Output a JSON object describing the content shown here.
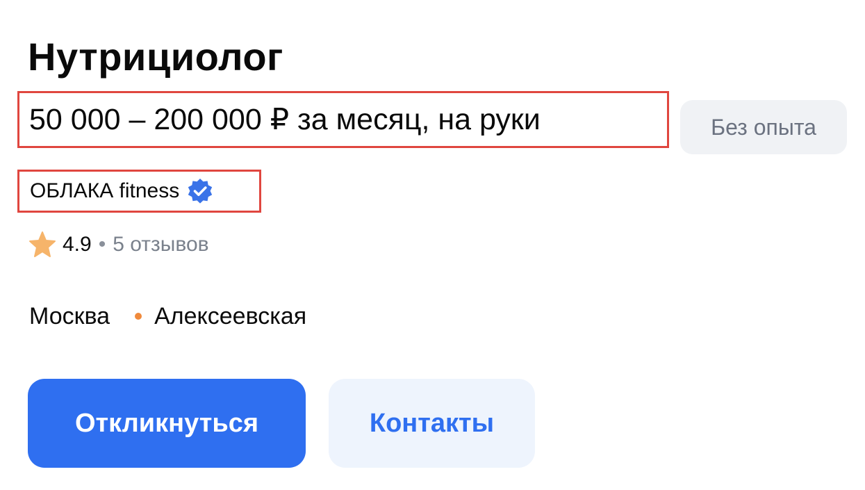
{
  "vacancy": {
    "title": "Нутрициолог",
    "salary": "50 000 – 200 000 ₽ за месяц, на руки",
    "experience_badge": "Без опыта"
  },
  "employer": {
    "name": "ОБЛАКА fitness",
    "verified_icon": "verified-check-icon",
    "rating": "4.9",
    "separator": "•",
    "reviews": "5 отзывов",
    "star_icon": "star-icon"
  },
  "location": {
    "city": "Москва",
    "metro": "Алексеевская",
    "metro_color": "#f08a3c"
  },
  "actions": {
    "apply_label": "Откликнуться",
    "contacts_label": "Контакты"
  },
  "colors": {
    "accent": "#2f6ff0",
    "highlight_border": "#e0463f"
  }
}
